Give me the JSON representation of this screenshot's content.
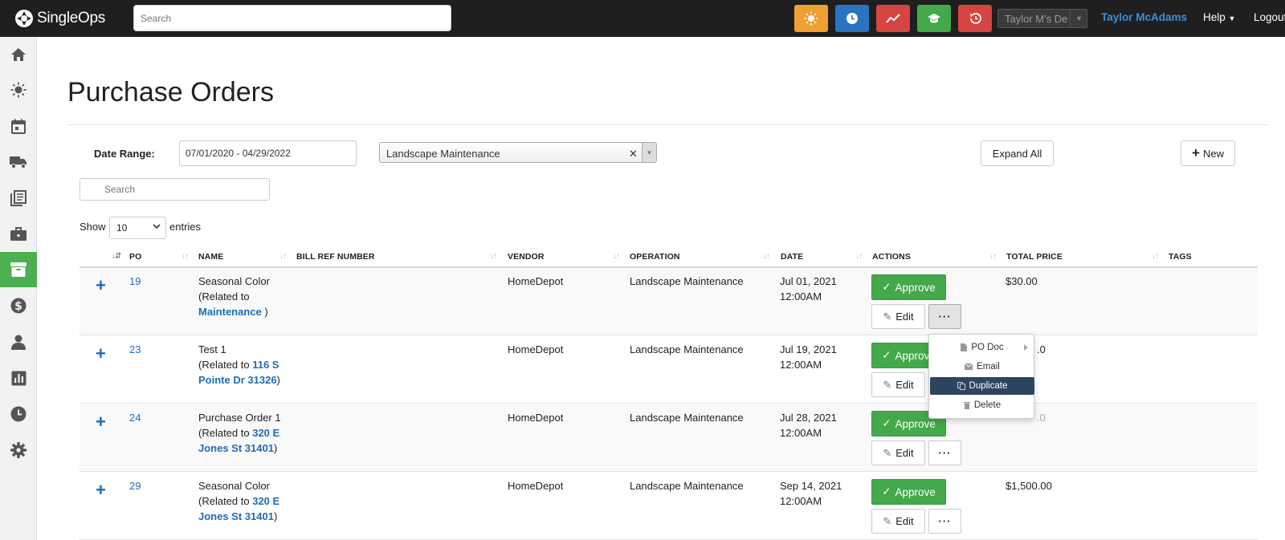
{
  "app": {
    "brand": "SingleOps"
  },
  "topbar": {
    "search_placeholder": "Search",
    "account_select": "Taylor M's De",
    "user_name": "Taylor McAdams",
    "help_label": "Help",
    "logout_label": "Logout",
    "quick_buttons": [
      {
        "icon": "sun-icon",
        "color": "#f0a030"
      },
      {
        "icon": "clock-icon",
        "color": "#2b73c2"
      },
      {
        "icon": "trend-line-icon",
        "color": "#d64541"
      },
      {
        "icon": "graduation-cap-icon",
        "color": "#43a94a"
      },
      {
        "icon": "history-icon",
        "color": "#d64541"
      }
    ]
  },
  "sidebar": {
    "items": [
      {
        "icon": "home-icon"
      },
      {
        "icon": "sun-icon"
      },
      {
        "icon": "calendar-icon"
      },
      {
        "icon": "truck-icon"
      },
      {
        "icon": "documents-icon"
      },
      {
        "icon": "briefcase-icon"
      },
      {
        "icon": "archive-icon",
        "active": true
      },
      {
        "icon": "dollar-icon"
      },
      {
        "icon": "user-icon"
      },
      {
        "icon": "bar-chart-icon"
      },
      {
        "icon": "clock-icon"
      },
      {
        "icon": "gear-icon"
      }
    ],
    "active_color": "#4caf50"
  },
  "page": {
    "title": "Purchase Orders",
    "filters": {
      "date_range_label": "Date Range:",
      "date_range_value": "07/01/2020 - 04/29/2022",
      "operation_value": "Landscape Maintenance",
      "expand_all_label": "Expand All",
      "new_label": "New"
    },
    "search_placeholder": "Search",
    "length": {
      "show_label": "Show",
      "value": "10",
      "entries_label": "entries"
    }
  },
  "table": {
    "columns": [
      "PO",
      "NAME",
      "BILL REF NUMBER",
      "VENDOR",
      "OPERATION",
      "DATE",
      "ACTIONS",
      "TOTAL PRICE",
      "TAGS"
    ],
    "approve_label": "Approve",
    "edit_label": "Edit",
    "more_label": "···",
    "rows": [
      {
        "po": "19",
        "name": "Seasonal Color",
        "related_prefix": "(Related to",
        "related_link": "Maintenance",
        "related_suffix": " )",
        "vendor": "HomeDepot",
        "operation": "Landscape Maintenance",
        "date": "Jul 01, 2021",
        "time": "12:00AM",
        "total": "$30.00"
      },
      {
        "po": "23",
        "name": "Test 1",
        "related_prefix": "(Related to",
        "related_link_1": "116 S",
        "related_link_2": "Pointe Dr 31326",
        "related_suffix": ")",
        "vendor": "HomeDepot",
        "operation": "Landscape Maintenance",
        "date": "Jul 19, 2021",
        "time": "12:00AM",
        "total_partial": ".0"
      },
      {
        "po": "24",
        "name": "Purchase Order 1",
        "related_prefix": "(Related to",
        "related_link_1": "320 E",
        "related_link_2": "Jones St 31401",
        "related_suffix": ")",
        "vendor": "HomeDepot",
        "operation": "Landscape Maintenance",
        "date": "Jul 28, 2021",
        "time": "12:00AM",
        "total_partial": ".0"
      },
      {
        "po": "29",
        "name": "Seasonal Color",
        "related_prefix": "(Related to",
        "related_link_1": "320 E",
        "related_link_2": "Jones St 31401",
        "related_suffix": ")",
        "vendor": "HomeDepot",
        "operation": "Landscape Maintenance",
        "date": "Sep 14, 2021",
        "time": "12:00AM",
        "total": "$1,500.00"
      }
    ]
  },
  "actions_menu": {
    "items": [
      {
        "label": "PO Doc",
        "icon": "document-icon",
        "has_submenu": true
      },
      {
        "label": "Email",
        "icon": "envelope-icon"
      },
      {
        "label": "Duplicate",
        "icon": "copy-icon",
        "highlighted": true
      },
      {
        "label": "Delete",
        "icon": "trash-icon"
      }
    ]
  }
}
